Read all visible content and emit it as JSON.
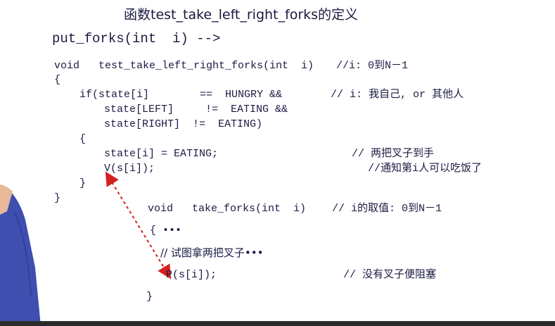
{
  "title": "函数test_take_left_right_forks的定义",
  "subtitle": "put_forks(int  i) -->",
  "code": {
    "l1": "void   test_take_left_right_forks(int  i)",
    "l1_comment": "//i: 0到N－1",
    "l2": "{",
    "l3": "if(state[i]        ==  HUNGRY &&",
    "l3_comment": "// i: 我自己, or 其他人",
    "l4": "state[LEFT]     !=  EATING &&",
    "l5": "state[RIGHT]  !=  EATING)",
    "l6": "{",
    "l7": "state[i] = EATING;",
    "l7_comment": "// 两把叉子到手",
    "l8": "V(s[i]);",
    "l8_comment": "//通知第i人可以吃饭了",
    "l9": "}",
    "l10": "}"
  },
  "inner": {
    "l1": "void   take_forks(int  i)",
    "l1_comment": "// i的取值: 0到N－1",
    "l2": "{ •••",
    "l3": "// 试图拿两把叉子•••",
    "l4": "P(s[i]);",
    "l4_comment": "// 没有叉子便阻塞",
    "l5": "}"
  },
  "colors": {
    "text": "#1c1c44",
    "arrow": "#d42020",
    "shirt": "#3f4fb0",
    "skin": "#e8b89a"
  }
}
